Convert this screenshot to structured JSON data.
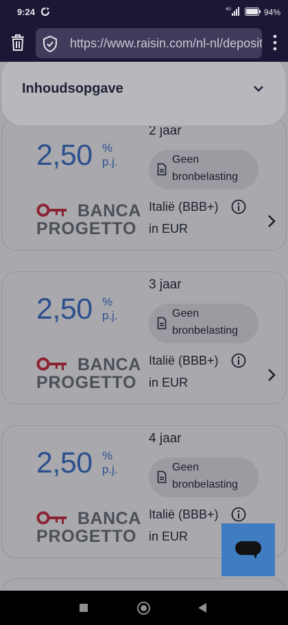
{
  "status_bar": {
    "time": "9:24",
    "network": "4G",
    "battery": "94%"
  },
  "browser": {
    "url": "https://www.raisin.com/nl-nl/deposito"
  },
  "toc": {
    "title": "Inhoudsopgave"
  },
  "cards": [
    {
      "rate": "2,50",
      "percent": "%",
      "per_year": "p.j.",
      "term": "2 jaar",
      "tax_line1": "Geen",
      "tax_line2": "bronbelasting",
      "bank_line1": "BANCA",
      "bank_line2": "PROGETTO",
      "country": "Italië (BBB+)",
      "currency": "in EUR"
    },
    {
      "rate": "2,50",
      "percent": "%",
      "per_year": "p.j.",
      "term": "3 jaar",
      "tax_line1": "Geen",
      "tax_line2": "bronbelasting",
      "bank_line1": "BANCA",
      "bank_line2": "PROGETTO",
      "country": "Italië (BBB+)",
      "currency": "in EUR"
    },
    {
      "rate": "2,50",
      "percent": "%",
      "per_year": "p.j.",
      "term": "4 jaar",
      "tax_line1": "Geen",
      "tax_line2": "bronbelasting",
      "bank_line1": "BANCA",
      "bank_line2": "PROGETTO",
      "country": "Italië (BBB+)",
      "currency": "in EUR"
    }
  ],
  "colors": {
    "rate_blue": "#2c4f8d",
    "chat_blue": "#3f7cc0",
    "logo_red": "#8b2232",
    "header_bg": "#1c1734"
  }
}
